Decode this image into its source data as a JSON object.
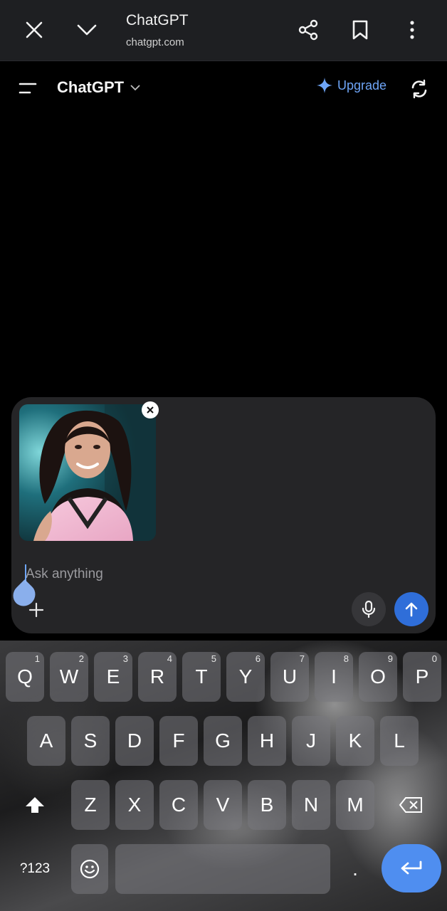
{
  "browser": {
    "title": "ChatGPT",
    "url": "chatgpt.com",
    "icons": [
      "close-icon",
      "chevron-down-icon",
      "share-icon",
      "bookmark-icon",
      "more-vertical-icon"
    ]
  },
  "app": {
    "title": "ChatGPT",
    "upgrade_label": "Upgrade",
    "accent": "#6ea5f7"
  },
  "composer": {
    "placeholder": "Ask anything",
    "value": "",
    "send_color": "#2f6ed9"
  },
  "keyboard": {
    "rows": [
      [
        {
          "k": "Q",
          "n": "1"
        },
        {
          "k": "W",
          "n": "2"
        },
        {
          "k": "E",
          "n": "3"
        },
        {
          "k": "R",
          "n": "4"
        },
        {
          "k": "T",
          "n": "5"
        },
        {
          "k": "Y",
          "n": "6"
        },
        {
          "k": "U",
          "n": "7"
        },
        {
          "k": "I",
          "n": "8"
        },
        {
          "k": "O",
          "n": "9"
        },
        {
          "k": "P",
          "n": "0"
        }
      ],
      [
        {
          "k": "A"
        },
        {
          "k": "S"
        },
        {
          "k": "D"
        },
        {
          "k": "F"
        },
        {
          "k": "G"
        },
        {
          "k": "H"
        },
        {
          "k": "J"
        },
        {
          "k": "K"
        },
        {
          "k": "L"
        }
      ],
      [
        {
          "k": "Z"
        },
        {
          "k": "X"
        },
        {
          "k": "C"
        },
        {
          "k": "V"
        },
        {
          "k": "B"
        },
        {
          "k": "N"
        },
        {
          "k": "M"
        }
      ]
    ],
    "symbols_label": "?123",
    "period": ".",
    "enter_color": "#4f8ef0"
  }
}
